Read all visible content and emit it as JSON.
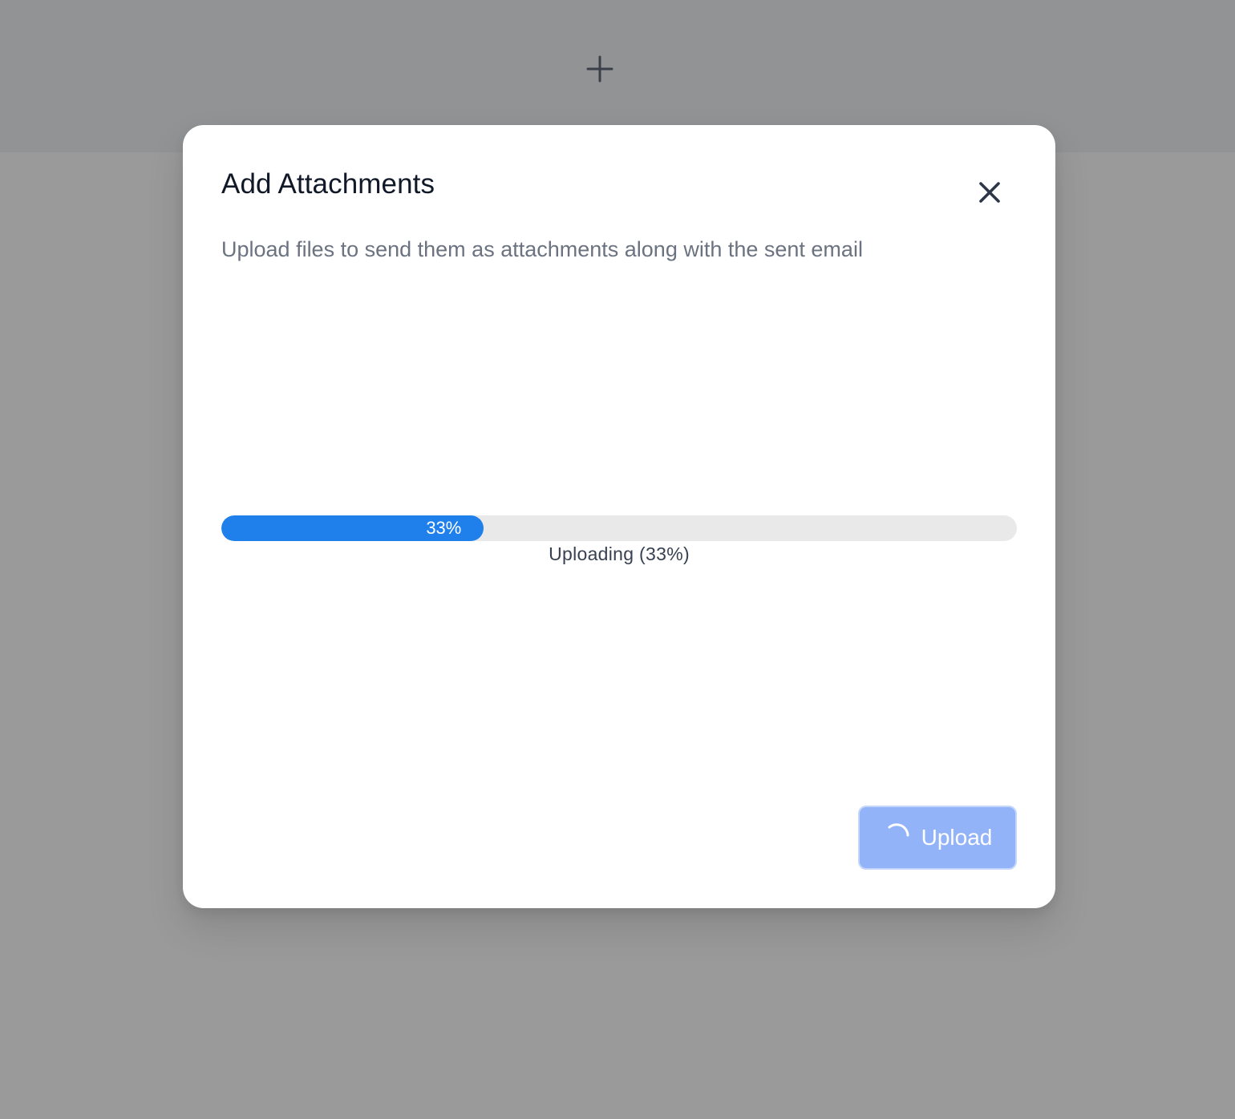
{
  "background": {
    "add_icon": "plus-icon"
  },
  "modal": {
    "title": "Add Attachments",
    "close_icon": "close-icon",
    "description": "Upload files to send them as attachments along with the sent email",
    "progress": {
      "percent": 33,
      "bar_label": "33%",
      "status_text": "Uploading (33%)",
      "fill_color": "#1f80ec",
      "track_color": "#e9e9e9"
    },
    "upload_button": {
      "label": "Upload",
      "state": "loading",
      "icon": "spinner-icon",
      "color": "#93b3f8"
    }
  }
}
